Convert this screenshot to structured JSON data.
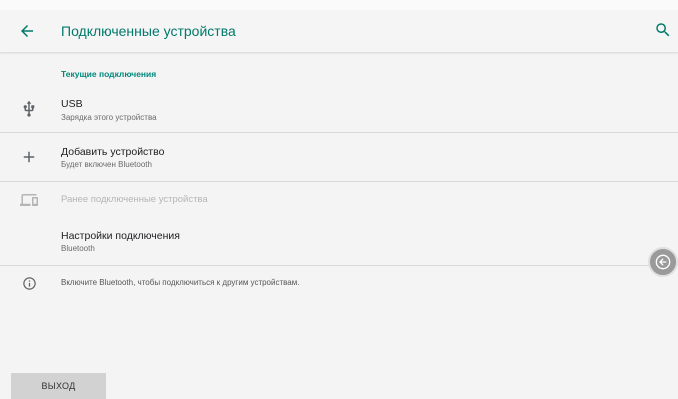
{
  "appbar": {
    "title": "Подключенные устройства",
    "back_icon": "arrow-left-icon",
    "search_icon": "search-icon"
  },
  "current_section": {
    "header": "Текущие подключения"
  },
  "rows": [
    {
      "title": "USB",
      "subtitle": "Зарядка этого устройства",
      "icon": "usb-icon"
    },
    {
      "title": "Добавить устройство",
      "subtitle": "Будет включен Bluetooth",
      "icon": "plus-icon"
    }
  ],
  "previous_devices": {
    "label": "Ранее подключенные устройства",
    "icon": "devices-icon"
  },
  "connection_settings": {
    "title": "Настройки подключения",
    "subtitle": "Bluetooth"
  },
  "info": {
    "text": "Включите Bluetooth, чтобы подключиться к другим устройствам.",
    "icon": "info-icon"
  },
  "exit_button": {
    "label": "ВЫХОД"
  },
  "colors": {
    "accent": "#00796b",
    "background": "#f4f4f4"
  }
}
